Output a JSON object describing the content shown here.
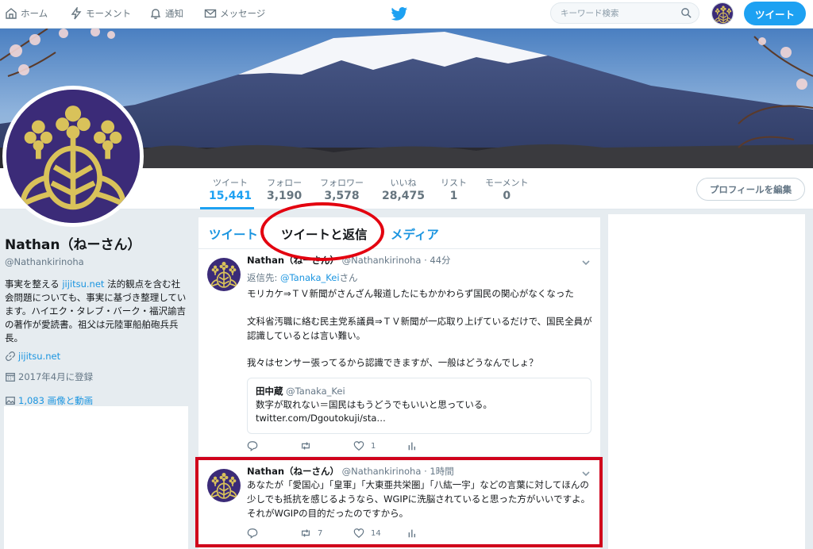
{
  "nav": {
    "home": "ホーム",
    "moments": "モーメント",
    "notifications": "通知",
    "messages": "メッセージ",
    "search_placeholder": "キーワード検索",
    "tweet_button": "ツイート"
  },
  "stats": [
    {
      "label": "ツイート",
      "value": "15,441"
    },
    {
      "label": "フォロー",
      "value": "3,190"
    },
    {
      "label": "フォロワー",
      "value": "3,578"
    },
    {
      "label": "いいね",
      "value": "28,475"
    },
    {
      "label": "リスト",
      "value": "1"
    },
    {
      "label": "モーメント",
      "value": "0"
    }
  ],
  "edit_profile": "プロフィールを編集",
  "profile": {
    "name": "Nathan（ねーさん）",
    "handle": "@Nathankirinoha",
    "bio_pre": "事実を整える ",
    "bio_link": "jijitsu.net",
    "bio_post": " 法的観点を含む社会問題についても、事実に基づき整理しています。ハイエク・タレブ・バーク・福沢諭吉の著作が愛読書。祖父は元陸軍船舶砲兵兵長。",
    "website": "jijitsu.net",
    "joined": "2017年4月に登録",
    "media": "1,083 画像と動画"
  },
  "tabs": {
    "tweets": "ツイート",
    "tweets_replies": "ツイートと返信",
    "media": "メディア"
  },
  "tweets": [
    {
      "name": "Nathan（ねーさん）",
      "handle": "@Nathankirinoha",
      "time": "· 44分",
      "reply_prefix": "返信先: ",
      "reply_to": "@Tanaka_Kei",
      "reply_suffix": "さん",
      "p1": "モリカケ⇒ＴＶ新聞がさんざん報道したにもかかわらず国民の関心がなくなった",
      "p2": "文科省汚職に絡む民主党系議員⇒ＴＶ新聞が一応取り上げているだけで、国民全員が認識しているとは言い難い。",
      "p3": "我々はセンサー張ってるから認識できますが、一般はどうなんでしょ？",
      "quote_name": "田中蔵",
      "quote_handle": "@Tanaka_Kei",
      "quote_text": "数字が取れない＝国民はもうどうでもいいと思っている。",
      "quote_link": "twitter.com/Dgoutokuji/sta…",
      "retweets": "",
      "likes": "1"
    },
    {
      "name": "Nathan（ねーさん）",
      "handle": "@Nathankirinoha",
      "time": "· 1時間",
      "text": "あなたが「愛国心」「皇軍」「大東亜共栄圏」「八紘一宇」などの言葉に対してほんの少しでも抵抗を感じるようなら、WGIPに洗脳されていると思った方がいいですよ。それがWGIPの目的だったのですから。",
      "retweets": "7",
      "likes": "14"
    }
  ],
  "colors": {
    "accent": "#1da1f2",
    "link": "#1b95e0",
    "annotation_red": "#e3000f",
    "background": "#e6ecf0"
  }
}
